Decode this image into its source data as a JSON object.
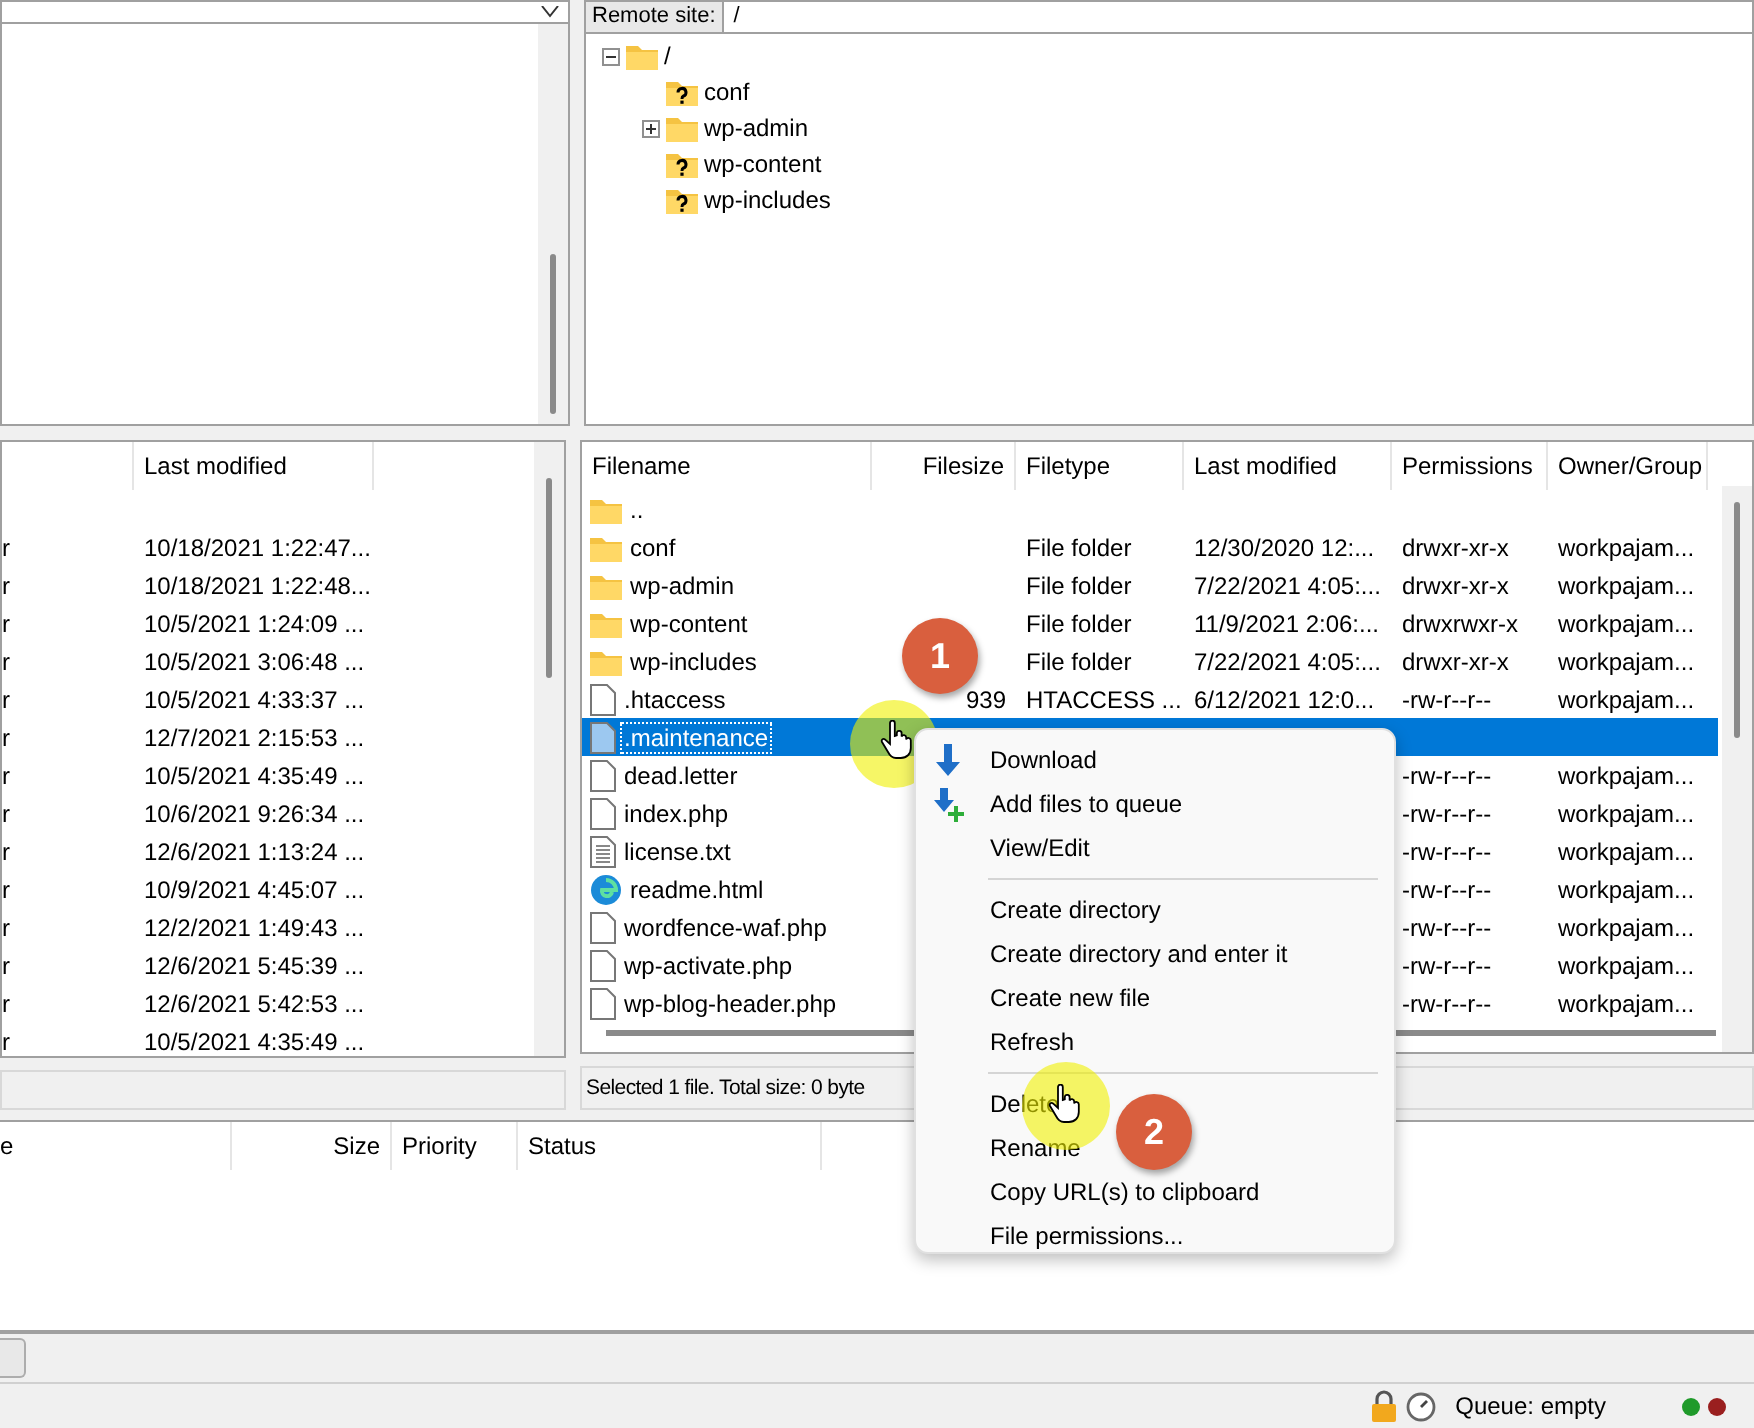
{
  "remote_site": {
    "label": "Remote site:",
    "value": "/"
  },
  "remote_tree": {
    "label": "/",
    "kind": "folder",
    "expanded": true,
    "children": [
      {
        "label": "conf",
        "kind": "unknown"
      },
      {
        "label": "wp-admin",
        "kind": "folder",
        "expanded": false
      },
      {
        "label": "wp-content",
        "kind": "unknown"
      },
      {
        "label": "wp-includes",
        "kind": "unknown"
      }
    ]
  },
  "local_list": {
    "columns": [
      "Last modified"
    ],
    "rows": [
      {
        "column_1": "r",
        "modified": "10/18/2021 1:22:47..."
      },
      {
        "column_1": "r",
        "modified": "10/18/2021 1:22:48..."
      },
      {
        "column_1": "r",
        "modified": "10/5/2021 1:24:09 ..."
      },
      {
        "column_1": "r",
        "modified": "10/5/2021 3:06:48 ..."
      },
      {
        "column_1": "r",
        "modified": "10/5/2021 4:33:37 ..."
      },
      {
        "column_1": "r",
        "modified": "12/7/2021 2:15:53 ..."
      },
      {
        "column_1": "r",
        "modified": "10/5/2021 4:35:49 ..."
      },
      {
        "column_1": "r",
        "modified": "10/6/2021 9:26:34 ..."
      },
      {
        "column_1": "r",
        "modified": "12/6/2021 1:13:24 ..."
      },
      {
        "column_1": "r",
        "modified": "10/9/2021 4:45:07 ..."
      },
      {
        "column_1": "r",
        "modified": "12/2/2021 1:49:43 ..."
      },
      {
        "column_1": "r",
        "modified": "12/6/2021 5:45:39 ..."
      },
      {
        "column_1": "r",
        "modified": "12/6/2021 5:42:53 ..."
      },
      {
        "column_1": "r",
        "modified": "10/5/2021 4:35:49 ..."
      }
    ]
  },
  "remote_list": {
    "columns": [
      "Filename",
      "Filesize",
      "Filetype",
      "Last modified",
      "Permissions",
      "Owner/Group"
    ],
    "rows": [
      {
        "kind": "folder",
        "name": "..",
        "selected": false
      },
      {
        "kind": "folder",
        "name": "conf",
        "type": "File folder",
        "modified": "12/30/2020 12:...",
        "permissions": "drwxr-xr-x",
        "owner": "workpajam...",
        "selected": false
      },
      {
        "kind": "folder",
        "name": "wp-admin",
        "type": "File folder",
        "modified": "7/22/2021 4:05:...",
        "permissions": "drwxr-xr-x",
        "owner": "workpajam...",
        "selected": false
      },
      {
        "kind": "folder",
        "name": "wp-content",
        "type": "File folder",
        "modified": "11/9/2021 2:06:...",
        "permissions": "drwxrwxr-x",
        "owner": "workpajam...",
        "selected": false
      },
      {
        "kind": "folder",
        "name": "wp-includes",
        "type": "File folder",
        "modified": "7/22/2021 4:05:...",
        "permissions": "drwxr-xr-x",
        "owner": "workpajam...",
        "selected": false
      },
      {
        "kind": "file",
        "name": ".htaccess",
        "size": "939",
        "type": "HTACCESS ...",
        "modified": "6/12/2021 12:0...",
        "permissions": "-rw-r--r--",
        "owner": "workpajam...",
        "selected": false
      },
      {
        "kind": "file",
        "name": ".maintenance",
        "selected": true
      },
      {
        "kind": "file",
        "name": "dead.letter",
        "permissions": "-rw-r--r--",
        "owner": "workpajam...",
        "selected": false
      },
      {
        "kind": "file",
        "name": "index.php",
        "permissions": "-rw-r--r--",
        "owner": "workpajam...",
        "selected": false
      },
      {
        "kind": "text",
        "name": "license.txt",
        "permissions": "-rw-r--r--",
        "owner": "workpajam...",
        "selected": false
      },
      {
        "kind": "web",
        "name": "readme.html",
        "permissions": "-rw-r--r--",
        "owner": "workpajam...",
        "selected": false
      },
      {
        "kind": "file",
        "name": "wordfence-waf.php",
        "permissions": "-rw-r--r--",
        "owner": "workpajam...",
        "selected": false
      },
      {
        "kind": "file",
        "name": "wp-activate.php",
        "permissions": "-rw-r--r--",
        "owner": "workpajam...",
        "selected": false
      },
      {
        "kind": "file",
        "name": "wp-blog-header.php",
        "permissions": "-rw-r--r--",
        "owner": "workpajam...",
        "selected": false
      }
    ],
    "status": "Selected 1 file. Total size: 0 byte"
  },
  "context_menu": [
    {
      "kind": "download",
      "label": "Download"
    },
    {
      "kind": "queue",
      "label": "Add files to queue"
    },
    {
      "kind": "item",
      "label": "View/Edit"
    },
    {
      "kind": "separator"
    },
    {
      "kind": "item",
      "label": "Create directory"
    },
    {
      "kind": "item",
      "label": "Create directory and enter it"
    },
    {
      "kind": "item",
      "label": "Create new file"
    },
    {
      "kind": "item",
      "label": "Refresh"
    },
    {
      "kind": "separator"
    },
    {
      "kind": "item",
      "label": "Delete"
    },
    {
      "kind": "item",
      "label": "Rename"
    },
    {
      "kind": "item",
      "label": "Copy URL(s) to clipboard"
    },
    {
      "kind": "item",
      "label": "File permissions..."
    }
  ],
  "step_badges": [
    "1",
    "2"
  ],
  "queue": {
    "columns": [
      "e",
      "Size",
      "Priority",
      "Status"
    ]
  },
  "status_bar": {
    "queue": "Queue: empty"
  }
}
